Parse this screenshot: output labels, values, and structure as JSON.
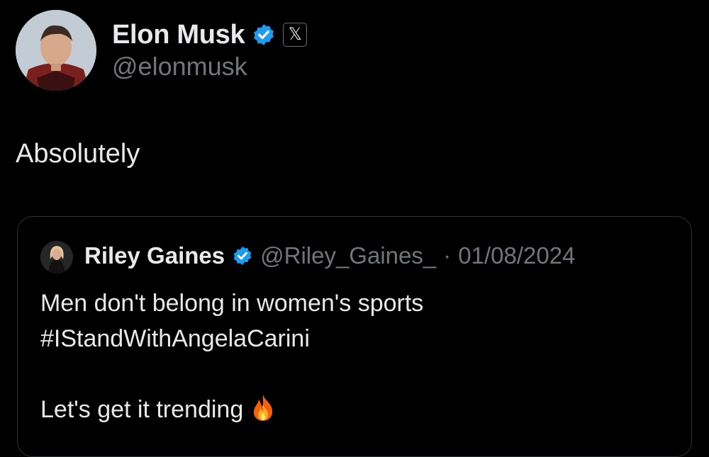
{
  "tweet": {
    "author": {
      "display_name": "Elon Musk",
      "handle": "@elonmusk",
      "verified": true,
      "affiliation_badge": "𝕏"
    },
    "text": "Absolutely"
  },
  "quoted_tweet": {
    "author": {
      "display_name": "Riley Gaines",
      "handle": "@Riley_Gaines_",
      "verified": true
    },
    "separator": "·",
    "date": "01/08/2024",
    "lines": [
      "Men don't belong in women's sports",
      "#IStandWithAngelaCarini",
      "",
      "Let's get it trending"
    ],
    "trailing_emoji_icon": "fire-icon"
  },
  "colors": {
    "background": "#000000",
    "primary_text": "#e7e9ea",
    "secondary_text": "#71767b",
    "border": "#2f3336",
    "verified_blue": "#1d9bf0"
  }
}
